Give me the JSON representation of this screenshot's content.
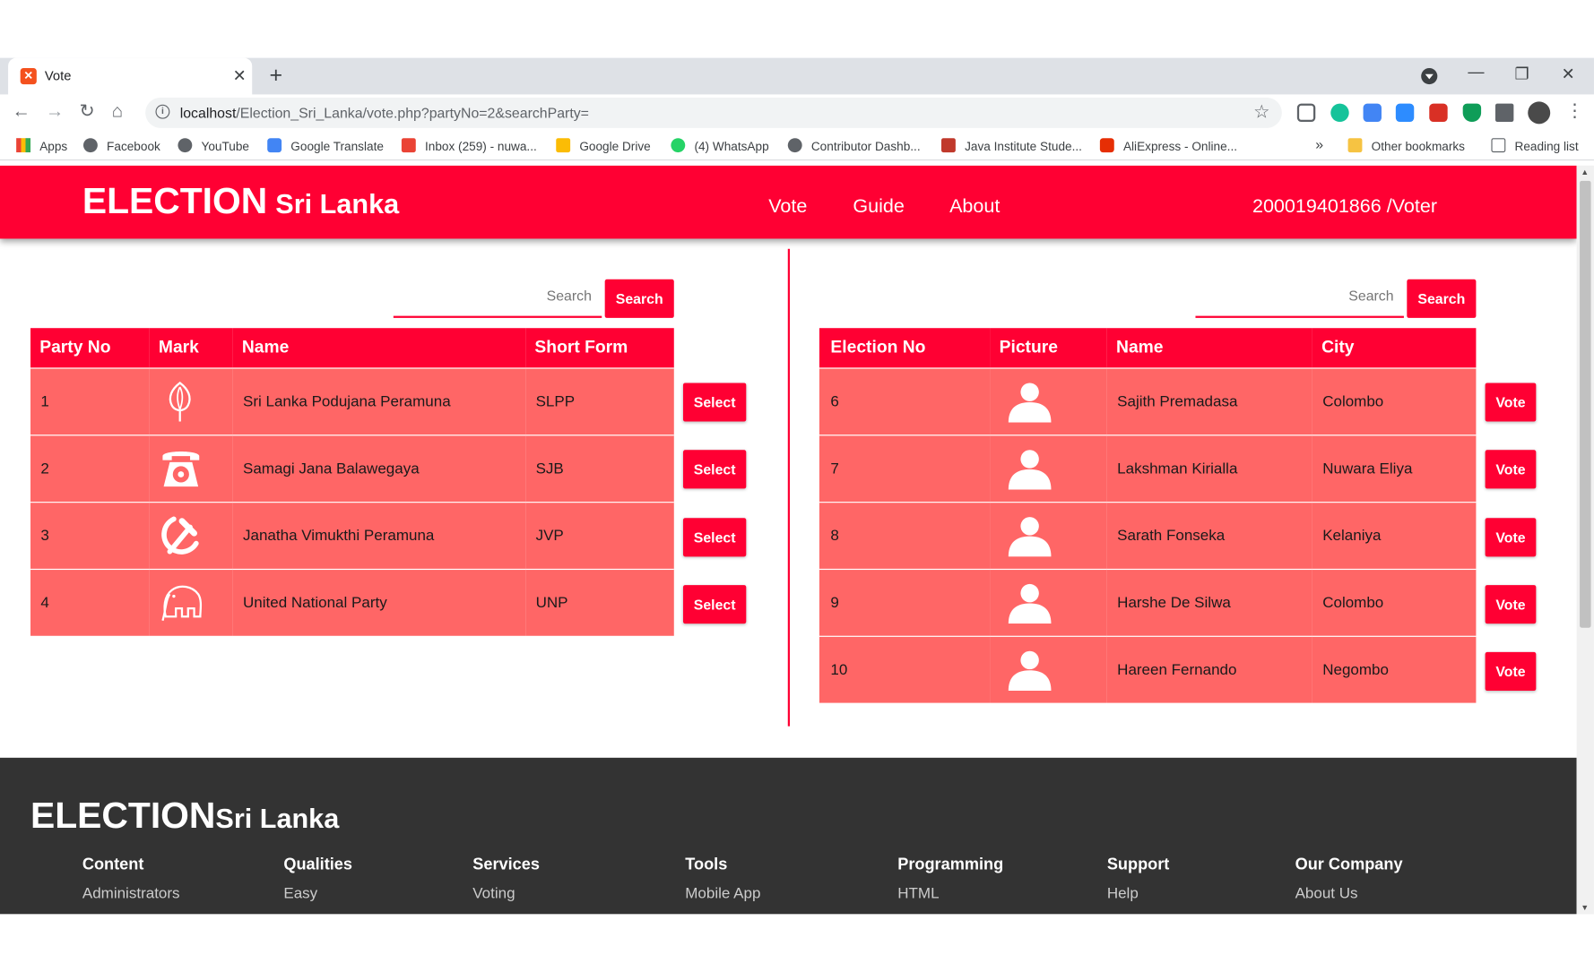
{
  "browser": {
    "tab_title": "Vote",
    "url_host": "localhost",
    "url_path": "/Election_Sri_Lanka/vote.php?partyNo=2&searchParty=",
    "bookmarks": [
      "Apps",
      "Facebook",
      "YouTube",
      "Google Translate",
      "Inbox (259) - nuwa...",
      "Google Drive",
      "(4) WhatsApp",
      "Contributor Dashb...",
      "Java Institute Stude...",
      "AliExpress - Online...",
      "Other bookmarks",
      "Reading list"
    ],
    "bookmarks_overflow": "»"
  },
  "header": {
    "brand_main": "ELECTION",
    "brand_sub": "Sri Lanka",
    "nav": [
      "Vote",
      "Guide",
      "About"
    ],
    "user": "200019401866 /Voter"
  },
  "parties": {
    "search_placeholder": "Search",
    "search_button": "Search",
    "columns": [
      "Party No",
      "Mark",
      "Name",
      "Short Form"
    ],
    "action_label": "Select",
    "rows": [
      {
        "no": "1",
        "mark": "lotus-bud-icon",
        "name": "Sri Lanka Podujana Peramuna",
        "short": "SLPP"
      },
      {
        "no": "2",
        "mark": "telephone-icon",
        "name": "Samagi Jana Balawegaya",
        "short": "SJB"
      },
      {
        "no": "3",
        "mark": "hammer-sickle-icon",
        "name": "Janatha Vimukthi Peramuna",
        "short": "JVP"
      },
      {
        "no": "4",
        "mark": "elephant-icon",
        "name": "United National Party",
        "short": "UNP"
      }
    ]
  },
  "candidates": {
    "search_placeholder": "Search",
    "search_button": "Search",
    "columns": [
      "Election No",
      "Picture",
      "Name",
      "City"
    ],
    "action_label": "Vote",
    "rows": [
      {
        "no": "6",
        "name": "Sajith Premadasa",
        "city": "Colombo"
      },
      {
        "no": "7",
        "name": "Lakshman Kirialla",
        "city": "Nuwara Eliya"
      },
      {
        "no": "8",
        "name": "Sarath Fonseka",
        "city": "Kelaniya"
      },
      {
        "no": "9",
        "name": "Harshe De Silwa",
        "city": "Colombo"
      },
      {
        "no": "10",
        "name": "Hareen Fernando",
        "city": "Negombo"
      }
    ]
  },
  "footer": {
    "brand_main": "ELECTION",
    "brand_sub": "Sri Lanka",
    "columns": [
      {
        "heading": "Content",
        "item": "Administrators"
      },
      {
        "heading": "Qualities",
        "item": "Easy"
      },
      {
        "heading": "Services",
        "item": "Voting"
      },
      {
        "heading": "Tools",
        "item": "Mobile App"
      },
      {
        "heading": "Programming",
        "item": "HTML"
      },
      {
        "heading": "Support",
        "item": "Help"
      },
      {
        "heading": "Our Company",
        "item": "About Us"
      }
    ]
  },
  "colors": {
    "accent": "#ff0033",
    "row_bg": "#ff6666",
    "footer_bg": "#333333"
  }
}
